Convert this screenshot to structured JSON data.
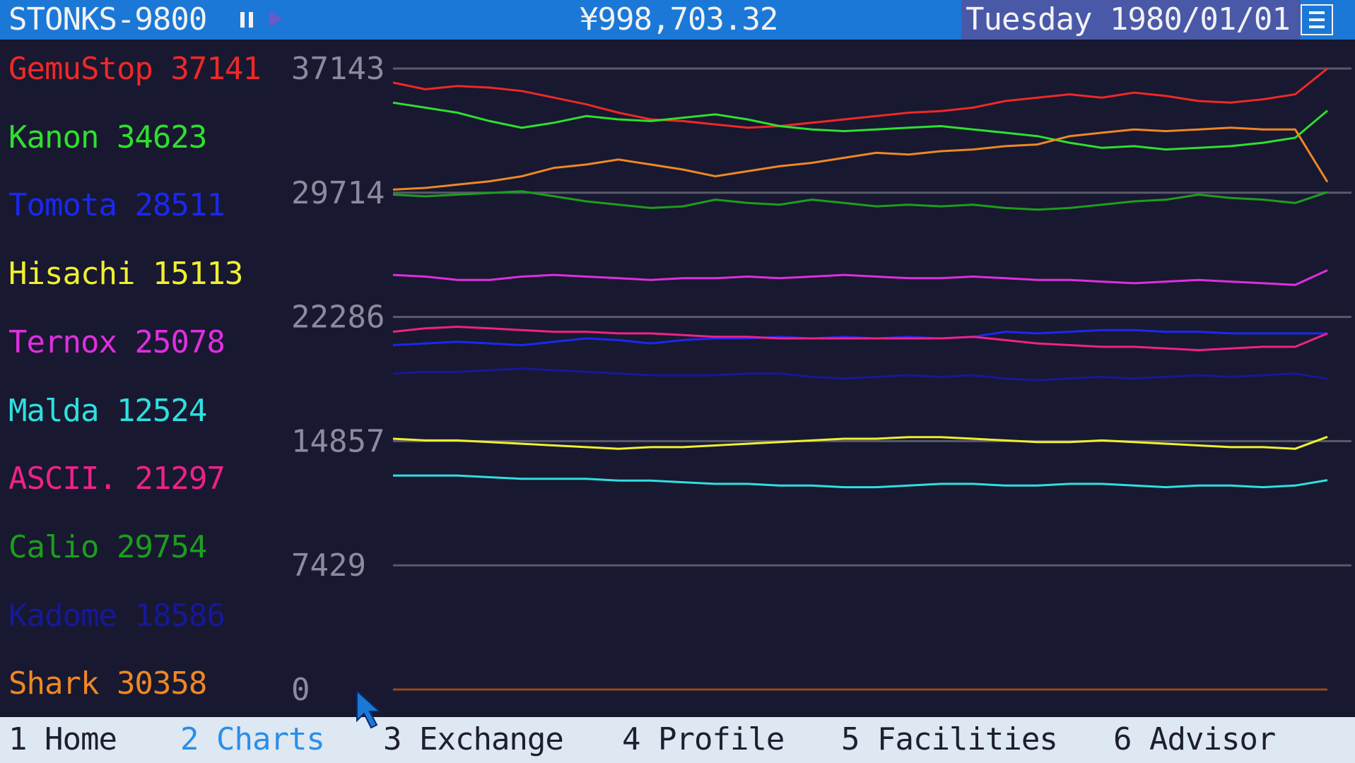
{
  "header": {
    "title": "STONKS-9800",
    "money": "¥998,703.32",
    "date": "Tuesday 1980/01/01",
    "icons": {
      "pause": "pause-icon",
      "play": "play-icon",
      "menu": "menu-icon"
    }
  },
  "legend": [
    {
      "name": "GemuStop",
      "value": "37141",
      "color": "#ee2828"
    },
    {
      "name": "Kanon",
      "value": "34623",
      "color": "#2ee02e"
    },
    {
      "name": "Tomota",
      "value": "28511",
      "color": "#1a28f0"
    },
    {
      "name": "Hisachi",
      "value": "15113",
      "color": "#f0f02e"
    },
    {
      "name": "Ternox",
      "value": "25078",
      "color": "#e02ee0"
    },
    {
      "name": "Malda",
      "value": "12524",
      "color": "#2ee0e0"
    },
    {
      "name": "ASCII.",
      "value": "21297",
      "color": "#ee2288"
    },
    {
      "name": "Calio",
      "value": "29754",
      "color": "#1c9e1c"
    },
    {
      "name": "Kadome",
      "value": "18586",
      "color": "#16189a"
    },
    {
      "name": "Shark",
      "value": "30358",
      "color": "#ee8822"
    }
  ],
  "chart_data": {
    "type": "line",
    "ylim": [
      0,
      37143
    ],
    "yticks": [
      "37143",
      "29714",
      "22286",
      "14857",
      "7429",
      "0"
    ],
    "ytick_values": [
      37143,
      29714,
      22286,
      14857,
      7429,
      0
    ],
    "grid": true,
    "series": [
      {
        "name": "GemuStop",
        "color": "#ee2828",
        "values": [
          36300,
          35900,
          36100,
          36000,
          35800,
          35400,
          35000,
          34500,
          34100,
          34000,
          33800,
          33600,
          33700,
          33900,
          34100,
          34300,
          34500,
          34600,
          34800,
          35200,
          35400,
          35600,
          35400,
          35700,
          35500,
          35200,
          35100,
          35300,
          35600,
          37141
        ]
      },
      {
        "name": "Kanon",
        "color": "#2ee02e",
        "values": [
          35100,
          34800,
          34500,
          34000,
          33600,
          33900,
          34300,
          34100,
          34000,
          34200,
          34400,
          34100,
          33700,
          33500,
          33400,
          33500,
          33600,
          33700,
          33500,
          33300,
          33100,
          32700,
          32400,
          32500,
          32300,
          32400,
          32500,
          32700,
          33000,
          34623
        ]
      },
      {
        "name": "Tomota",
        "color": "#1a28f0",
        "values": [
          20600,
          20700,
          20800,
          20700,
          20600,
          20800,
          21000,
          20900,
          20700,
          20900,
          21000,
          21000,
          21100,
          21000,
          21100,
          21000,
          21100,
          21000,
          21100,
          21400,
          21300,
          21400,
          21500,
          21500,
          21400,
          21400,
          21300,
          21300,
          21300,
          21300
        ]
      },
      {
        "name": "Hisachi",
        "color": "#f0f02e",
        "values": [
          15000,
          14900,
          14900,
          14800,
          14700,
          14600,
          14500,
          14400,
          14500,
          14500,
          14600,
          14700,
          14800,
          14900,
          15000,
          15000,
          15100,
          15100,
          15000,
          14900,
          14800,
          14800,
          14900,
          14800,
          14700,
          14600,
          14500,
          14500,
          14400,
          15113
        ]
      },
      {
        "name": "Ternox",
        "color": "#e02ee0",
        "values": [
          24800,
          24700,
          24500,
          24500,
          24700,
          24800,
          24700,
          24600,
          24500,
          24600,
          24600,
          24700,
          24600,
          24700,
          24800,
          24700,
          24600,
          24600,
          24700,
          24600,
          24500,
          24500,
          24400,
          24300,
          24400,
          24500,
          24400,
          24300,
          24200,
          25078
        ]
      },
      {
        "name": "Malda",
        "color": "#2ee0e0",
        "values": [
          12800,
          12800,
          12800,
          12700,
          12600,
          12600,
          12600,
          12500,
          12500,
          12400,
          12300,
          12300,
          12200,
          12200,
          12100,
          12100,
          12200,
          12300,
          12300,
          12200,
          12200,
          12300,
          12300,
          12200,
          12100,
          12200,
          12200,
          12100,
          12200,
          12524
        ]
      },
      {
        "name": "ASCII.",
        "color": "#ee2288",
        "values": [
          21400,
          21600,
          21700,
          21600,
          21500,
          21400,
          21400,
          21300,
          21300,
          21200,
          21100,
          21100,
          21000,
          21000,
          21000,
          21000,
          21000,
          21000,
          21100,
          20900,
          20700,
          20600,
          20500,
          20500,
          20400,
          20300,
          20400,
          20500,
          20500,
          21297
        ]
      },
      {
        "name": "Calio",
        "color": "#1c9e1c",
        "values": [
          29600,
          29500,
          29600,
          29700,
          29800,
          29500,
          29200,
          29000,
          28800,
          28900,
          29300,
          29100,
          29000,
          29300,
          29100,
          28900,
          29000,
          28900,
          29000,
          28800,
          28700,
          28800,
          29000,
          29200,
          29300,
          29600,
          29400,
          29300,
          29100,
          29754
        ]
      },
      {
        "name": "Kadome",
        "color": "#16189a",
        "values": [
          18900,
          19000,
          19000,
          19100,
          19200,
          19100,
          19000,
          18900,
          18800,
          18800,
          18800,
          18900,
          18900,
          18700,
          18600,
          18700,
          18800,
          18700,
          18800,
          18600,
          18500,
          18600,
          18700,
          18600,
          18700,
          18800,
          18700,
          18800,
          18900,
          18586
        ]
      },
      {
        "name": "Shark",
        "color": "#ee8822",
        "values": [
          29900,
          30000,
          30200,
          30400,
          30700,
          31200,
          31400,
          31700,
          31400,
          31100,
          30700,
          31000,
          31300,
          31500,
          31800,
          32100,
          32000,
          32200,
          32300,
          32500,
          32600,
          33100,
          33300,
          33500,
          33400,
          33500,
          33600,
          33500,
          33500,
          30358
        ]
      }
    ]
  },
  "bottom_tabs": [
    {
      "label": "1 Home",
      "active": false
    },
    {
      "label": "2 Charts",
      "active": true
    },
    {
      "label": "3 Exchange",
      "active": false
    },
    {
      "label": "4 Profile",
      "active": false
    },
    {
      "label": "5 Facilities",
      "active": false
    },
    {
      "label": "6 Advisor",
      "active": false
    }
  ]
}
